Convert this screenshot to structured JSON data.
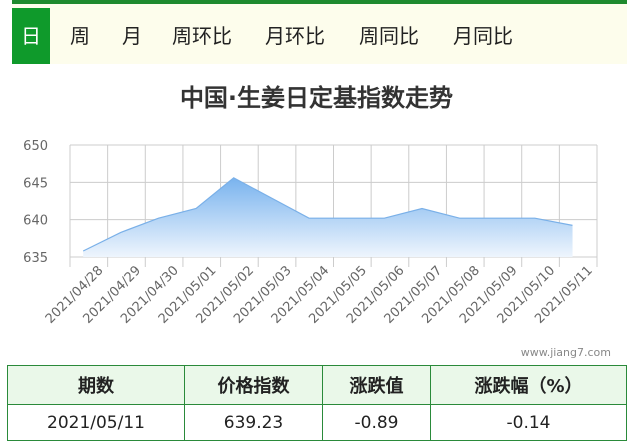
{
  "tabs": [
    {
      "label": "日",
      "active": true
    },
    {
      "label": "周",
      "active": false
    },
    {
      "label": "月",
      "active": false
    },
    {
      "label": "周环比",
      "active": false
    },
    {
      "label": "月环比",
      "active": false
    },
    {
      "label": "周同比",
      "active": false
    },
    {
      "label": "月同比",
      "active": false
    }
  ],
  "watermark": "www.jiang7.com",
  "chart_data": {
    "type": "area",
    "title": "中国·生姜日定基指数走势",
    "categories": [
      "2021/04/28",
      "2021/04/29",
      "2021/04/30",
      "2021/05/01",
      "2021/05/02",
      "2021/05/03",
      "2021/05/04",
      "2021/05/05",
      "2021/05/06",
      "2021/05/07",
      "2021/05/08",
      "2021/05/09",
      "2021/05/10",
      "2021/05/11"
    ],
    "series": [
      {
        "values": [
          635.8,
          638.3,
          640.2,
          641.5,
          645.6,
          642.9,
          640.2,
          640.2,
          640.2,
          641.5,
          640.2,
          640.2,
          640.2,
          639.23
        ]
      }
    ],
    "ylim": [
      635,
      650
    ],
    "yticks": [
      "635",
      "640",
      "645",
      "650"
    ],
    "grid": true,
    "colors": {
      "line": "#7ab0e8",
      "fill_top": "#79b3ee",
      "fill_bottom": "#eef5fd",
      "grid": "#cccccc"
    }
  },
  "table": {
    "headers": [
      "期数",
      "价格指数",
      "涨跌值",
      "涨跌幅（%）"
    ],
    "rows": [
      [
        "2021/05/11",
        "639.23",
        "-0.89",
        "-0.14"
      ]
    ]
  }
}
